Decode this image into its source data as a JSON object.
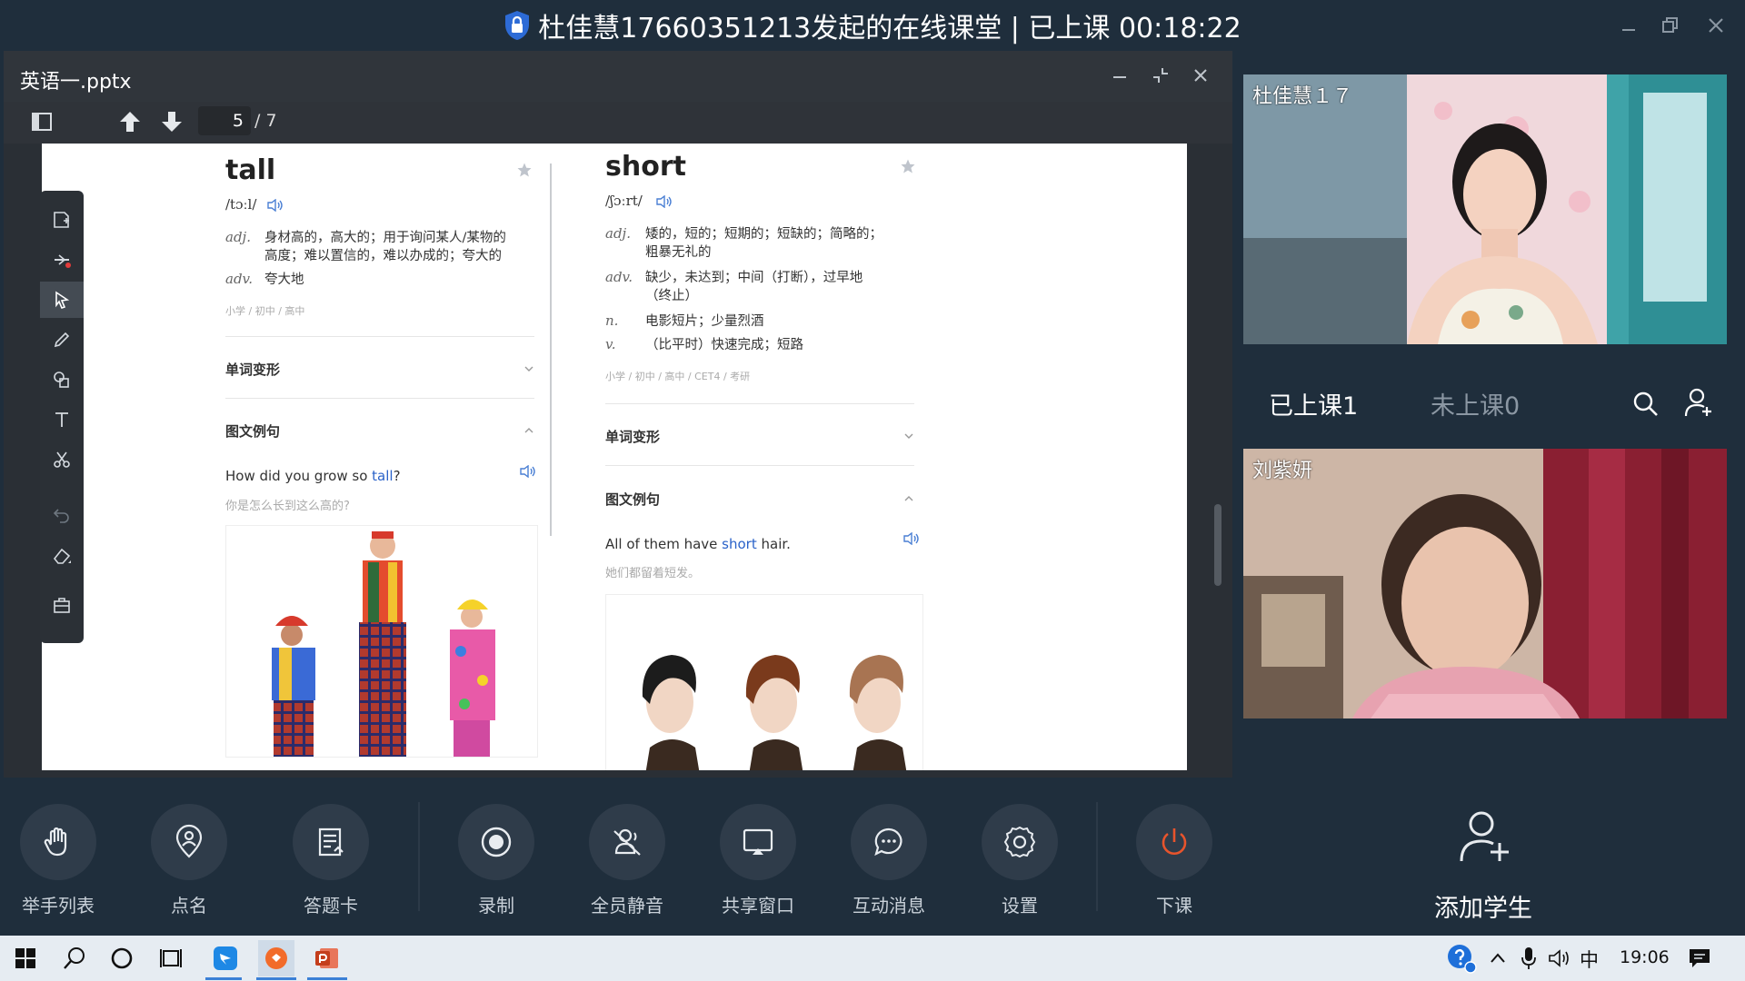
{
  "window": {
    "title": "杜佳慧17660351213发起的在线课堂 | 已上课 00:18:22"
  },
  "document": {
    "filename": "英语一.pptx",
    "page_current": "5",
    "page_total": "/ 7"
  },
  "slide": {
    "left_card": {
      "word": "tall",
      "phonetic": "/tɔːl/",
      "definitions": [
        {
          "pos": "adj.",
          "line1": "身材高的，高大的；用于询问某人/某物的",
          "line2": "高度；难以置信的，难以办成的；夸大的"
        },
        {
          "pos": "adv.",
          "line1": "夸大地"
        }
      ],
      "tags": "小学 / 初中 / 高中",
      "section_forms": "单词变形",
      "section_examples": "图文例句",
      "example_before": "How did you grow so ",
      "example_highlight": "tall",
      "example_after": "?",
      "example_translation": "你是怎么长到这么高的?"
    },
    "right_card": {
      "word": "short",
      "phonetic": "/ʃɔːrt/",
      "definitions": [
        {
          "pos": "adj.",
          "line1": "矮的，短的；短期的；短缺的；简略的；",
          "line2": "粗暴无礼的"
        },
        {
          "pos": "adv.",
          "line1": "缺少，未达到；中间（打断），过早地",
          "line2": "（终止）"
        },
        {
          "pos": "n.",
          "line1": "电影短片；少量烈酒"
        },
        {
          "pos": "v.",
          "line1": "（比平时）快速完成；短路"
        }
      ],
      "tags": "小学 / 初中 / 高中 / CET4 / 考研",
      "section_forms": "单词变形",
      "section_examples": "图文例句",
      "example_before": "All of them have ",
      "example_highlight": "short",
      "example_after": " hair.",
      "example_translation": "她们都留着短发。"
    }
  },
  "controls": [
    {
      "label": "举手列表",
      "icon": "raise-hand-icon"
    },
    {
      "label": "点名",
      "icon": "roll-call-icon"
    },
    {
      "label": "答题卡",
      "icon": "answer-card-icon"
    },
    {
      "label": "录制",
      "icon": "record-icon"
    },
    {
      "label": "全员静音",
      "icon": "mute-all-icon"
    },
    {
      "label": "共享窗口",
      "icon": "share-window-icon"
    },
    {
      "label": "互动消息",
      "icon": "chat-icon"
    },
    {
      "label": "设置",
      "icon": "gear-icon"
    },
    {
      "label": "下课",
      "icon": "power-icon"
    }
  ],
  "participants": {
    "teacher_name": "杜佳慧１７",
    "student_name": "刘紫妍",
    "tab_attended": "已上课1",
    "tab_absent": "未上课0",
    "add_student": "添加学生"
  },
  "taskbar": {
    "ime": "中",
    "clock": "19:06"
  },
  "colors": {
    "background": "#1f2e3c",
    "accent_highlight": "#2a62c9",
    "end_class": "#e8542c"
  }
}
